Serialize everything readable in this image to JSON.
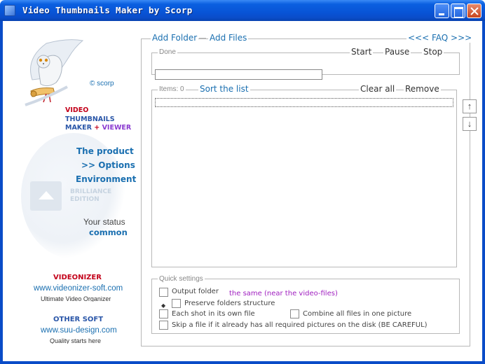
{
  "window": {
    "title": "Video Thumbnails Maker by Scorp",
    "accent": "#0a4cc8"
  },
  "sidebar": {
    "copyright": "© scorp",
    "logo_line1": "VIDEO",
    "logo_line2": "THUMBNAILS",
    "logo_line3a": "MAKER",
    "logo_plus": "+",
    "logo_line3b": "VIEWER",
    "nav": {
      "product": "The product",
      "options": ">> Options",
      "environment": "Environment"
    },
    "brilliance_line1": "BRILLIANCE",
    "brilliance_line2": "EDITION",
    "status_label": "Your status",
    "status_value": "common",
    "promo1": {
      "title": "VIDEONIZER",
      "url": "www.videonizer-soft.com",
      "tagline": "Ultimate Video Organizer"
    },
    "promo2": {
      "title": "OTHER SOFT",
      "url": "www.suu-design.com",
      "tagline": "Quality starts here"
    }
  },
  "toolbar": {
    "add_folder": "Add Folder",
    "add_files": "Add Files",
    "faq": "<<< FAQ >>>"
  },
  "progress": {
    "status": "Done",
    "start": "Start",
    "pause": "Pause",
    "stop": "Stop",
    "percent": 0
  },
  "list": {
    "items_label": "Items: 0",
    "sort": "Sort the list",
    "clear_all": "Clear all",
    "remove": "Remove",
    "move_up": "↑",
    "move_down": "↓"
  },
  "quick_settings": {
    "label": "Quick settings",
    "output_folder_label": "Output  folder",
    "output_folder_value": "the same (near the video-files)",
    "preserve_structure": "Preserve folders structure",
    "each_shot": "Each shot in its own file",
    "combine_all": "Combine all files in one picture",
    "skip_file": "Skip a file if it already has all required pictures on the disk (BE CAREFUL)"
  }
}
